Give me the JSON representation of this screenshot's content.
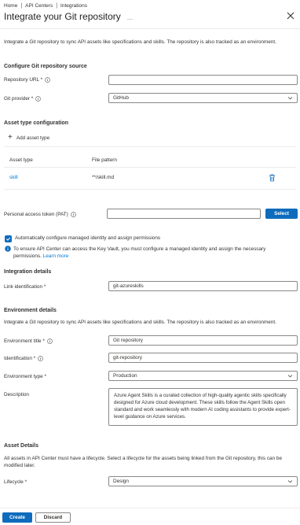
{
  "breadcrumb": [
    "Home",
    "API Centers",
    "Integrations"
  ],
  "page_title": "Integrate your Git repository",
  "more_label": "...",
  "intro": "Integrate a Git repository to sync API assets like specifications and skills. The repository is also tracked as an environment.",
  "source": {
    "heading": "Configure Git repository source",
    "repo_url_label": "Repository URL *",
    "repo_url_value": "",
    "provider_label": "Git provider *",
    "provider_value": "GitHub"
  },
  "asset_types": {
    "heading": "Asset type configuration",
    "add_label": "Add asset type",
    "columns": [
      "Asset type",
      "File pattern"
    ],
    "rows": [
      {
        "type": "skill",
        "pattern": "**/skill.md"
      }
    ]
  },
  "pat": {
    "label": "Personal access token (PAT)",
    "value": "",
    "select_label": "Select"
  },
  "managed_identity": {
    "checkbox_label": "Automatically configure managed identity and assign permissions",
    "info_text": "To ensure API Center can access the Key Vault, you must configure a managed identity and assign the necessary permissions.",
    "learn_more": "Learn more"
  },
  "integration": {
    "heading": "Integration details",
    "link_label": "Link identification *",
    "link_value": "git-azureskills"
  },
  "environment": {
    "heading": "Environment details",
    "intro": "Integrate a Git repository to sync API assets like specifications and skills. The repository is also tracked as an environment.",
    "title_label": "Environment title *",
    "title_value": "Git repository",
    "id_label": "Identification *",
    "id_value": "git-repository",
    "type_label": "Environment type *",
    "type_value": "Production",
    "desc_label": "Description",
    "desc_value": "Azure Agent Skills is a curated collection of high-quality agentic skills specifically designed for Azure cloud development. These skills follow the Agent Skills open standard and work seamlessly with modern AI coding assistants to provide expert-level guidance on Azure services."
  },
  "asset_details": {
    "heading": "Asset Details",
    "intro": "All assets in API Center must have a lifecycle. Select a lifecycle for the assets being linked from the Git repository, this can be modified later.",
    "lifecycle_label": "Lifecycle *",
    "lifecycle_value": "Design"
  },
  "footer": {
    "create_label": "Create",
    "discard_label": "Discard"
  },
  "colors": {
    "accent": "#0f6cbd",
    "link": "#0078d4",
    "border": "#8a8886",
    "divider": "#edebe9"
  }
}
